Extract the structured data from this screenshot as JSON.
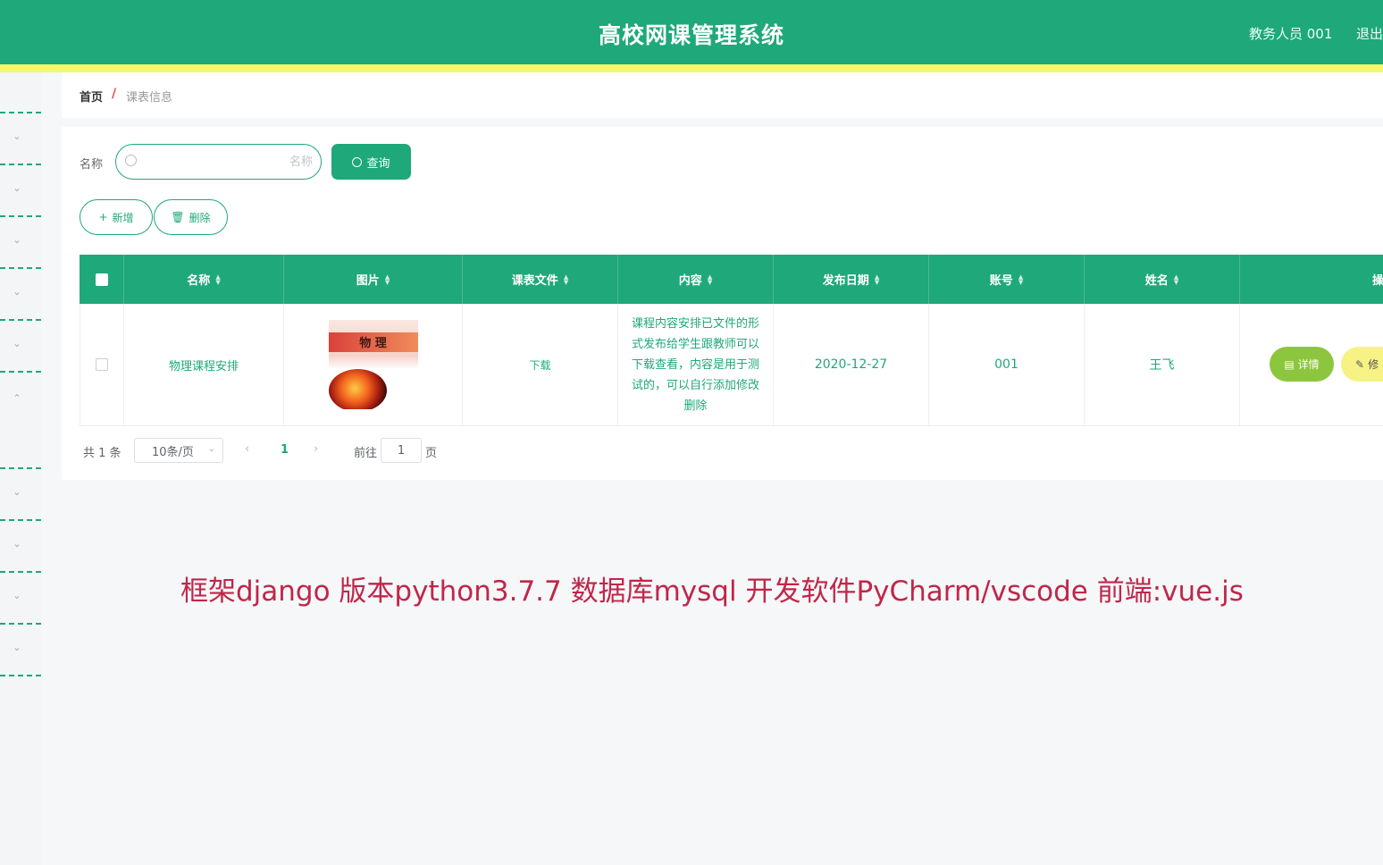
{
  "header": {
    "title": "高校网课管理系统",
    "user": "教务人员 001",
    "logout": "退出"
  },
  "breadcrumb": {
    "home": "首页",
    "separator": "/",
    "current": "课表信息"
  },
  "search": {
    "label": "名称",
    "placeholder": "名称",
    "query_label": "查询"
  },
  "actions": {
    "add_label": "新增",
    "delete_label": "删除"
  },
  "table": {
    "columns": [
      "名称",
      "图片",
      "课表文件",
      "内容",
      "发布日期",
      "账号",
      "姓名",
      "操作"
    ],
    "rows": [
      {
        "name": "物理课程安排",
        "image_title": "物 理",
        "file": "下载",
        "content": "课程内容安排已文件的形式发布给学生跟教师可以下载查看，内容是用于测试的，可以自行添加修改删除",
        "date": "2020-12-27",
        "account": "001",
        "person": "王飞",
        "detail_label": "详情",
        "edit_label": "修"
      }
    ]
  },
  "pagination": {
    "total": "共 1 条",
    "page_size": "10条/页",
    "current_page": "1",
    "goto_label": "前往",
    "goto_value": "1",
    "page_suffix": "页"
  },
  "caption": "框架django 版本python3.7.7 数据库mysql  开发软件PyCharm/vscode 前端:vue.js",
  "colors": {
    "primary": "#1fa87a",
    "accent_yellow": "#f4f86a",
    "detail_green": "#8cc63f",
    "caption_red": "#c1264a"
  }
}
